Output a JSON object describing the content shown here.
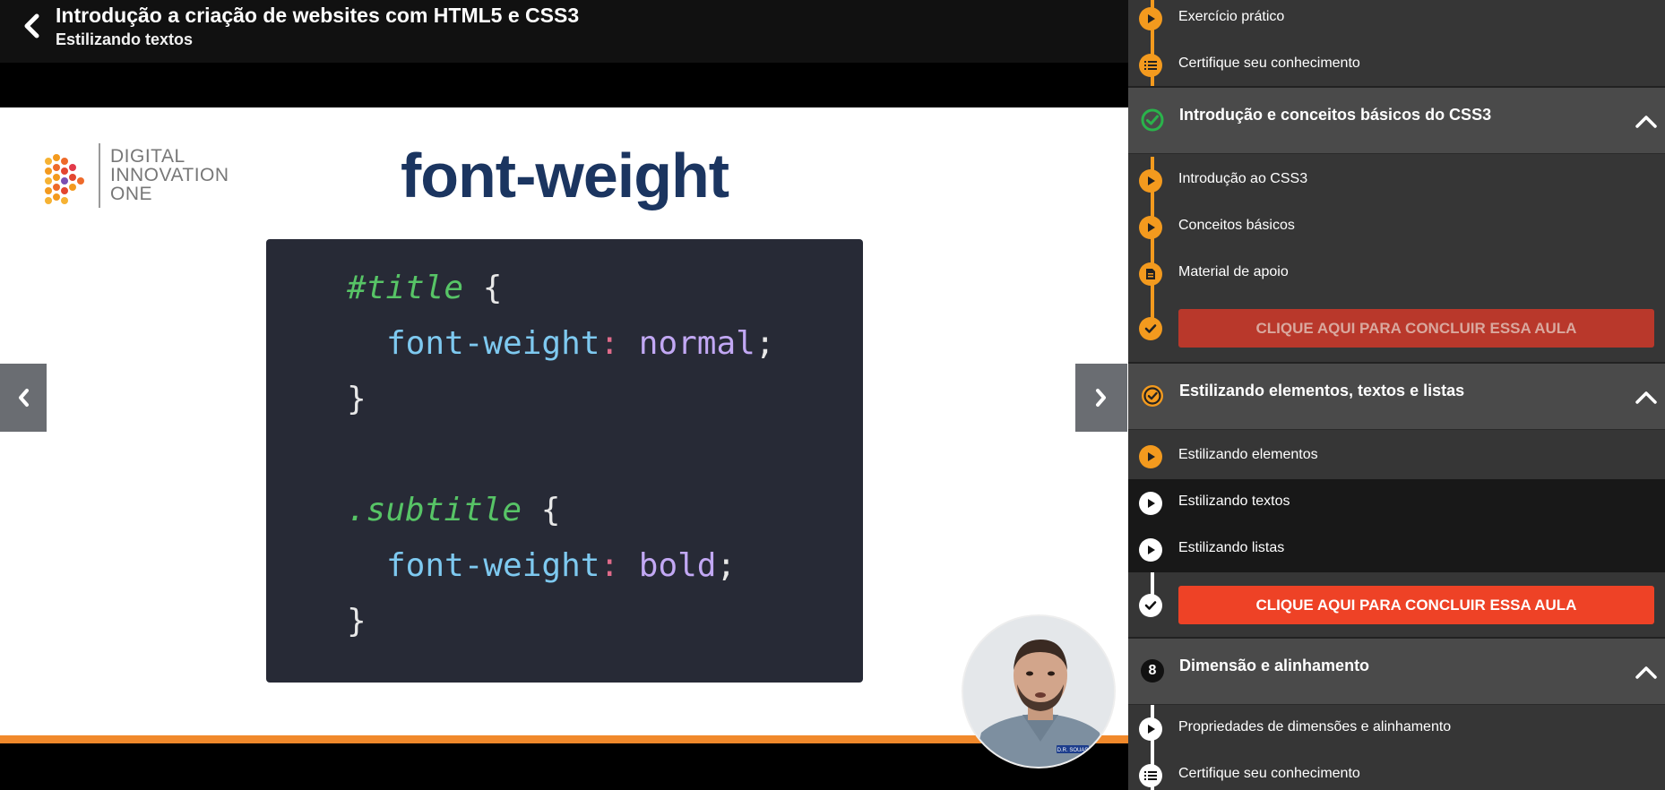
{
  "header": {
    "course_title": "Introdução a criação de websites com HTML5 e CSS3",
    "lesson_title": "Estilizando textos"
  },
  "slide": {
    "brand_lines": [
      "DIGITAL",
      "INNOVATION",
      "ONE"
    ],
    "heading": "font-weight",
    "code": {
      "l1_sel": "#title",
      "l1_brace": " {",
      "l2_prop": "font-weight",
      "l2_colon": ":",
      "l2_val": " normal",
      "l2_semi": ";",
      "l3_brace": "}",
      "l4_sel": ".subtitle",
      "l4_brace": " {",
      "l5_prop": "font-weight",
      "l5_colon": ":",
      "l5_val": " bold",
      "l5_semi": ";",
      "l6_brace": "}"
    },
    "instructor_badge": "D.R. SOUAS"
  },
  "sidebar": {
    "top_items": [
      {
        "label": "Exercício prático",
        "icon": "play-icon"
      },
      {
        "label": "Certifique seu conhecimento",
        "icon": "list-icon"
      }
    ],
    "module_css3": {
      "title": "Introdução e conceitos básicos do CSS3",
      "items": [
        {
          "label": "Introdução ao CSS3",
          "icon": "play-icon"
        },
        {
          "label": "Conceitos básicos",
          "icon": "play-icon"
        },
        {
          "label": "Material de apoio",
          "icon": "document-icon"
        }
      ],
      "conclude_label": "CLIQUE AQUI PARA CONCLUIR ESSA AULA"
    },
    "module_styling": {
      "title": "Estilizando elementos, textos e listas",
      "items": [
        {
          "label": "Estilizando elementos",
          "icon": "play-icon"
        },
        {
          "label": "Estilizando textos",
          "icon": "play-icon"
        },
        {
          "label": "Estilizando listas",
          "icon": "play-icon"
        }
      ],
      "conclude_label": "CLIQUE AQUI PARA CONCLUIR ESSA AULA"
    },
    "module_dimension": {
      "number": "8",
      "title": "Dimensão e alinhamento",
      "items": [
        {
          "label": "Propriedades de dimensões e alinhamento",
          "icon": "play-icon"
        },
        {
          "label": "Certifique seu conhecimento",
          "icon": "list-icon"
        }
      ]
    }
  },
  "colors": {
    "accent_orange": "#f39a1e",
    "conclude_red": "#ee4226",
    "conclude_red_muted": "#b9382b",
    "check_green": "#2ab34b",
    "slide_heading": "#1b3560"
  }
}
